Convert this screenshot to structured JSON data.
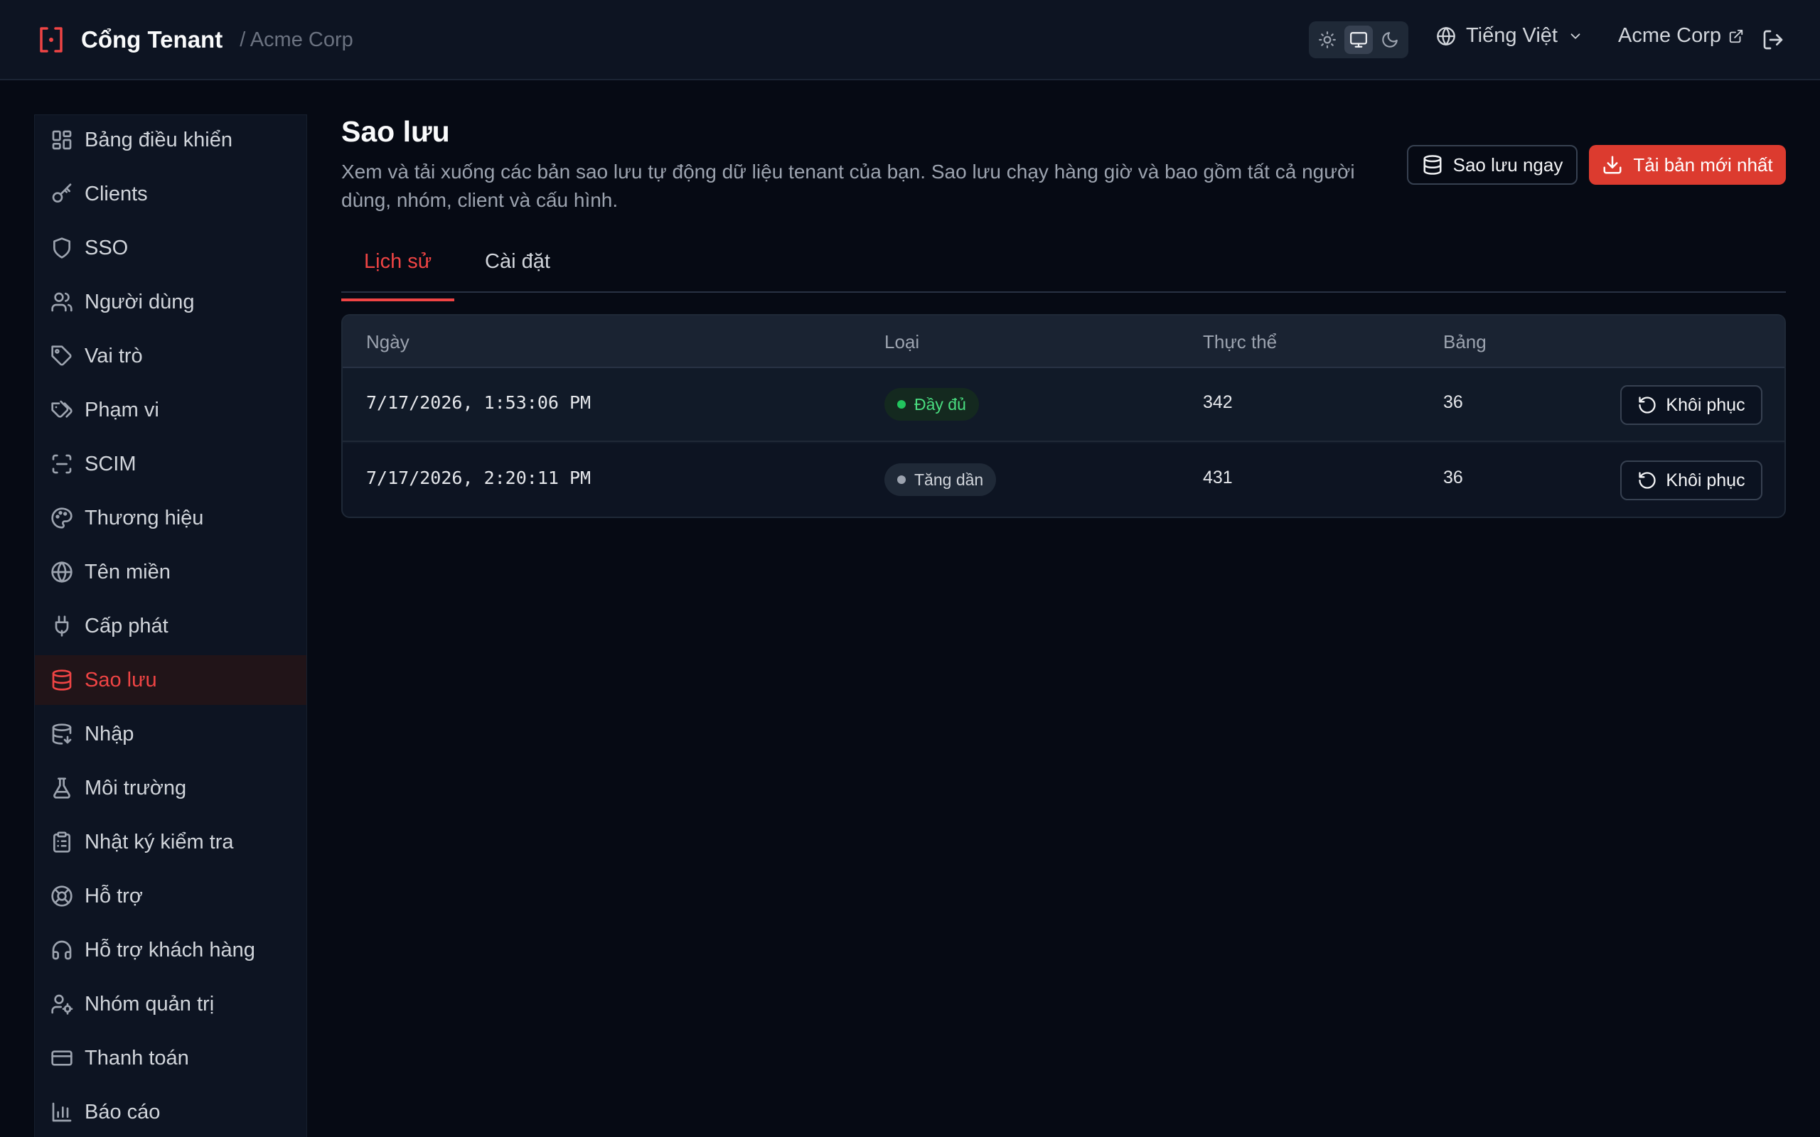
{
  "header": {
    "brand": "Cổng Tenant",
    "breadcrumb": "/ Acme Corp",
    "language": "Tiếng Việt",
    "org": "Acme Corp"
  },
  "sidebar": {
    "items": [
      {
        "label": "Bảng điều khiển",
        "icon": "dashboard-icon"
      },
      {
        "label": "Clients",
        "icon": "key-icon"
      },
      {
        "label": "SSO",
        "icon": "shield-icon"
      },
      {
        "label": "Người dùng",
        "icon": "users-icon"
      },
      {
        "label": "Vai trò",
        "icon": "tag-icon"
      },
      {
        "label": "Phạm vi",
        "icon": "tags-icon"
      },
      {
        "label": "SCIM",
        "icon": "scan-icon"
      },
      {
        "label": "Thương hiệu",
        "icon": "palette-icon"
      },
      {
        "label": "Tên miền",
        "icon": "globe-icon"
      },
      {
        "label": "Cấp phát",
        "icon": "plug-icon"
      },
      {
        "label": "Sao lưu",
        "icon": "database-icon"
      },
      {
        "label": "Nhập",
        "icon": "database-import-icon"
      },
      {
        "label": "Môi trường",
        "icon": "flask-icon"
      },
      {
        "label": "Nhật ký kiểm tra",
        "icon": "clipboard-icon"
      },
      {
        "label": "Hỗ trợ",
        "icon": "lifebuoy-icon"
      },
      {
        "label": "Hỗ trợ khách hàng",
        "icon": "headset-icon"
      },
      {
        "label": "Nhóm quản trị",
        "icon": "user-cog-icon"
      },
      {
        "label": "Thanh toán",
        "icon": "credit-card-icon"
      },
      {
        "label": "Báo cáo",
        "icon": "bar-chart-icon"
      }
    ],
    "active_index": 10
  },
  "page": {
    "title": "Sao lưu",
    "description": "Xem và tải xuống các bản sao lưu tự động dữ liệu tenant của bạn. Sao lưu chạy hàng giờ và bao gồm tất cả người dùng, nhóm, client và cấu hình.",
    "backup_now_label": "Sao lưu ngay",
    "download_latest_label": "Tải bản mới nhất"
  },
  "tabs": [
    {
      "label": "Lịch sử",
      "active": true
    },
    {
      "label": "Cài đặt",
      "active": false
    }
  ],
  "table": {
    "columns": [
      "Ngày",
      "Loại",
      "Thực thể",
      "Bảng"
    ],
    "rows": [
      {
        "date": "7/17/2026, 1:53:06 PM",
        "type": "Đầy đủ",
        "type_kind": "full",
        "entities": "342",
        "tables": "36",
        "action": "Khôi phục"
      },
      {
        "date": "7/17/2026, 2:20:11 PM",
        "type": "Tăng dần",
        "type_kind": "incremental",
        "entities": "431",
        "tables": "36",
        "action": "Khôi phục"
      }
    ]
  },
  "colors": {
    "accent": "#ef4444",
    "primary_button": "#dc3b2f",
    "background": "#060a14",
    "success": "#22c55e"
  }
}
